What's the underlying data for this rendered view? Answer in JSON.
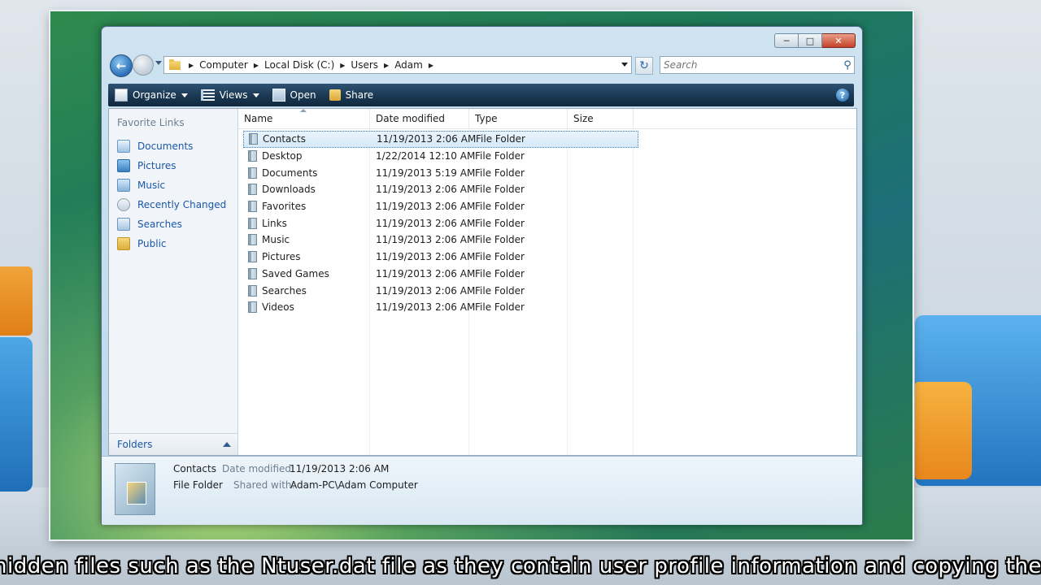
{
  "window": {
    "minimize_icon": "minimize-icon",
    "maximize_icon": "maximize-icon",
    "close_icon": "close-icon"
  },
  "address": {
    "crumbs": [
      "Computer",
      "Local Disk (C:)",
      "Users",
      "Adam"
    ]
  },
  "search": {
    "placeholder": "Search"
  },
  "toolbar": {
    "organize": "Organize",
    "views": "Views",
    "open": "Open",
    "share": "Share"
  },
  "sidebar": {
    "title": "Favorite Links",
    "items": [
      {
        "label": "Documents",
        "icon": "documents-icon"
      },
      {
        "label": "Pictures",
        "icon": "pictures-icon"
      },
      {
        "label": "Music",
        "icon": "music-icon"
      },
      {
        "label": "Recently Changed",
        "icon": "recently-changed-icon"
      },
      {
        "label": "Searches",
        "icon": "searches-icon"
      },
      {
        "label": "Public",
        "icon": "public-folder-icon"
      }
    ],
    "folders_label": "Folders"
  },
  "columns": {
    "name": "Name",
    "date": "Date modified",
    "type": "Type",
    "size": "Size"
  },
  "files": [
    {
      "name": "Contacts",
      "date": "11/19/2013 2:06 AM",
      "type": "File Folder"
    },
    {
      "name": "Desktop",
      "date": "1/22/2014 12:10 AM",
      "type": "File Folder"
    },
    {
      "name": "Documents",
      "date": "11/19/2013 5:19 AM",
      "type": "File Folder"
    },
    {
      "name": "Downloads",
      "date": "11/19/2013 2:06 AM",
      "type": "File Folder"
    },
    {
      "name": "Favorites",
      "date": "11/19/2013 2:06 AM",
      "type": "File Folder"
    },
    {
      "name": "Links",
      "date": "11/19/2013 2:06 AM",
      "type": "File Folder"
    },
    {
      "name": "Music",
      "date": "11/19/2013 2:06 AM",
      "type": "File Folder"
    },
    {
      "name": "Pictures",
      "date": "11/19/2013 2:06 AM",
      "type": "File Folder"
    },
    {
      "name": "Saved Games",
      "date": "11/19/2013 2:06 AM",
      "type": "File Folder"
    },
    {
      "name": "Searches",
      "date": "11/19/2013 2:06 AM",
      "type": "File Folder"
    },
    {
      "name": "Videos",
      "date": "11/19/2013 2:06 AM",
      "type": "File Folder"
    }
  ],
  "details": {
    "name": "Contacts",
    "type": "File Folder",
    "modified_label": "Date modified:",
    "modified_value": "11/19/2013 2:06 AM",
    "shared_label": "Shared with:",
    "shared_value": "Adam-PC\\Adam Computer"
  },
  "caption": "hidden files such as the Ntuser.dat file as they contain user profile information and copying them"
}
